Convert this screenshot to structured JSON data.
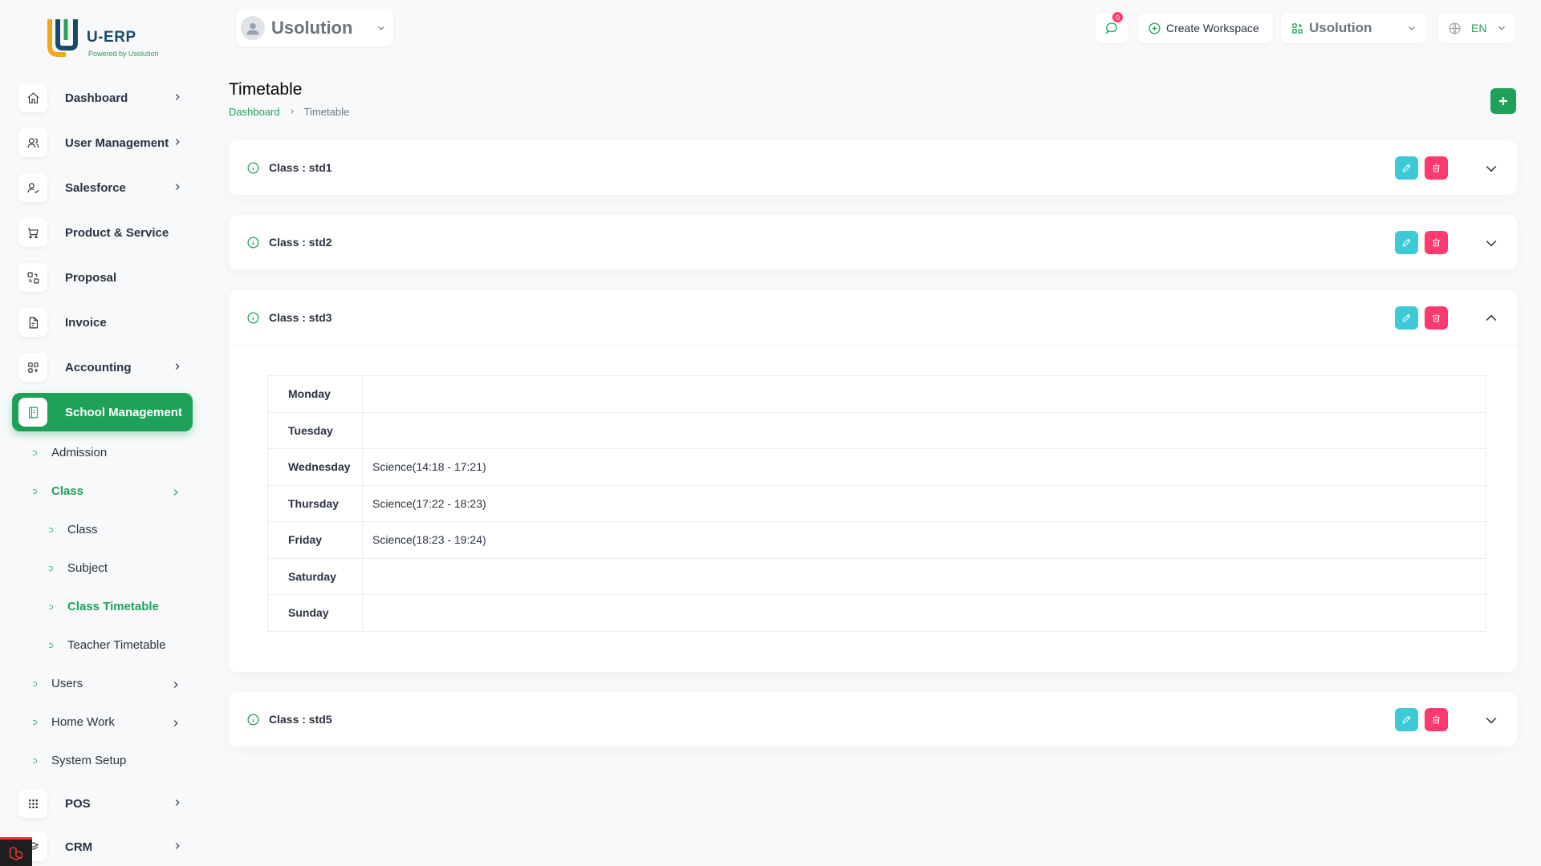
{
  "app": {
    "brand": "U-ERP",
    "tagline": "Powered by Usolution"
  },
  "sidebar": {
    "items": [
      {
        "label": "Dashboard",
        "icon": "home-icon",
        "has_children": true
      },
      {
        "label": "User Management",
        "icon": "users-icon",
        "has_children": true
      },
      {
        "label": "Salesforce",
        "icon": "user-check-icon",
        "has_children": true
      },
      {
        "label": "Product & Service",
        "icon": "shopping-cart-icon",
        "has_children": false
      },
      {
        "label": "Proposal",
        "icon": "replace-icon",
        "has_children": false
      },
      {
        "label": "Invoice",
        "icon": "file-invoice-icon",
        "has_children": false
      },
      {
        "label": "Accounting",
        "icon": "layout-grid-add-icon",
        "has_children": true
      },
      {
        "label": "School Management",
        "icon": "notebook-icon",
        "has_children": false,
        "active": true
      },
      {
        "label": "POS",
        "icon": "grid-dots-icon",
        "has_children": true
      },
      {
        "label": "CRM",
        "icon": "layers-icon",
        "has_children": true
      }
    ],
    "school_sub": {
      "admission": "Admission",
      "class": "Class",
      "class_children": [
        "Class",
        "Subject",
        "Class Timetable",
        "Teacher Timetable"
      ],
      "users": "Users",
      "home_work": "Home Work",
      "system_setup": "System Setup"
    }
  },
  "header": {
    "workspace_name": "Usolution",
    "message_count": "0",
    "create_workspace": "Create Workspace",
    "company": "Usolution",
    "language": "EN"
  },
  "page": {
    "title": "Timetable",
    "breadcrumb_home": "Dashboard",
    "breadcrumb_current": "Timetable"
  },
  "classes": [
    {
      "title": "Class : std1",
      "expanded": false
    },
    {
      "title": "Class : std2",
      "expanded": false
    },
    {
      "title": "Class : std3",
      "expanded": true
    },
    {
      "title": "Class : std5",
      "expanded": false
    }
  ],
  "timetable_std3": [
    {
      "day": "Monday",
      "entry": ""
    },
    {
      "day": "Tuesday",
      "entry": ""
    },
    {
      "day": "Wednesday",
      "entry": "Science(14:18 - 17:21)"
    },
    {
      "day": "Thursday",
      "entry": "Science(17:22 - 18:23)"
    },
    {
      "day": "Friday",
      "entry": "Science(18:23 - 19:24)"
    },
    {
      "day": "Saturday",
      "entry": ""
    },
    {
      "day": "Sunday",
      "entry": ""
    }
  ],
  "colors": {
    "primary": "#1fa15a",
    "edit": "#3ec9d6",
    "delete": "#ff3a6e",
    "text": "#293240"
  }
}
